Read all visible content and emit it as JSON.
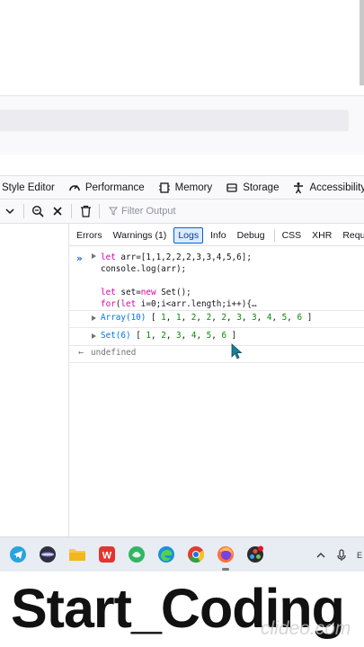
{
  "devtools": {
    "tools": [
      {
        "label": "Style Editor",
        "icon": "none"
      },
      {
        "label": "Performance",
        "icon": "performance-icon"
      },
      {
        "label": "Memory",
        "icon": "memory-icon"
      },
      {
        "label": "Storage",
        "icon": "storage-icon"
      },
      {
        "label": "Accessibility",
        "icon": "accessibility-icon"
      }
    ],
    "console_toolbar": {
      "filter_placeholder": "Filter Output"
    },
    "filter_tabs": [
      {
        "label": "Errors",
        "active": false
      },
      {
        "label": "Warnings (1)",
        "active": false
      },
      {
        "label": "Logs",
        "active": true
      },
      {
        "label": "Info",
        "active": false
      },
      {
        "label": "Debug",
        "active": false
      },
      {
        "label": "CSS",
        "active": false
      },
      {
        "label": "XHR",
        "active": false
      },
      {
        "label": "Requests",
        "active": false
      }
    ],
    "console": {
      "prompt": "»",
      "input_lines": [
        "let arr=[1,1,2,2,2,3,3,4,5,6];",
        "console.log(arr);",
        "",
        "let set=new Set();",
        "for(let i=0;i<arr.length;i++){…"
      ],
      "outputs": [
        {
          "type": "Array(10)",
          "items": [
            "1",
            "1",
            "2",
            "2",
            "2",
            "3",
            "3",
            "4",
            "5",
            "6"
          ]
        },
        {
          "type": "Set(6)",
          "items": [
            "1",
            "2",
            "3",
            "4",
            "5",
            "6"
          ]
        }
      ],
      "return_arrow": "←",
      "return_value": "undefined"
    }
  },
  "taskbar": {
    "apps": [
      "telegram-icon",
      "obs-icon",
      "file-explorer-icon",
      "wps-office-icon",
      "tooth-app-icon",
      "edge-icon",
      "chrome-icon",
      "firefox-icon",
      "davinci-resolve-icon"
    ],
    "active_app": "firefox-icon",
    "tray": [
      "chevron-up-icon",
      "microphone-icon"
    ],
    "tray_edge": "E"
  },
  "caption": {
    "text": "Start_Coding",
    "watermark": "clideo.com"
  },
  "colors": {
    "accent": "#0061e0",
    "keyword": "#dd00a9",
    "number": "#058b00",
    "type": "#0074e8"
  }
}
